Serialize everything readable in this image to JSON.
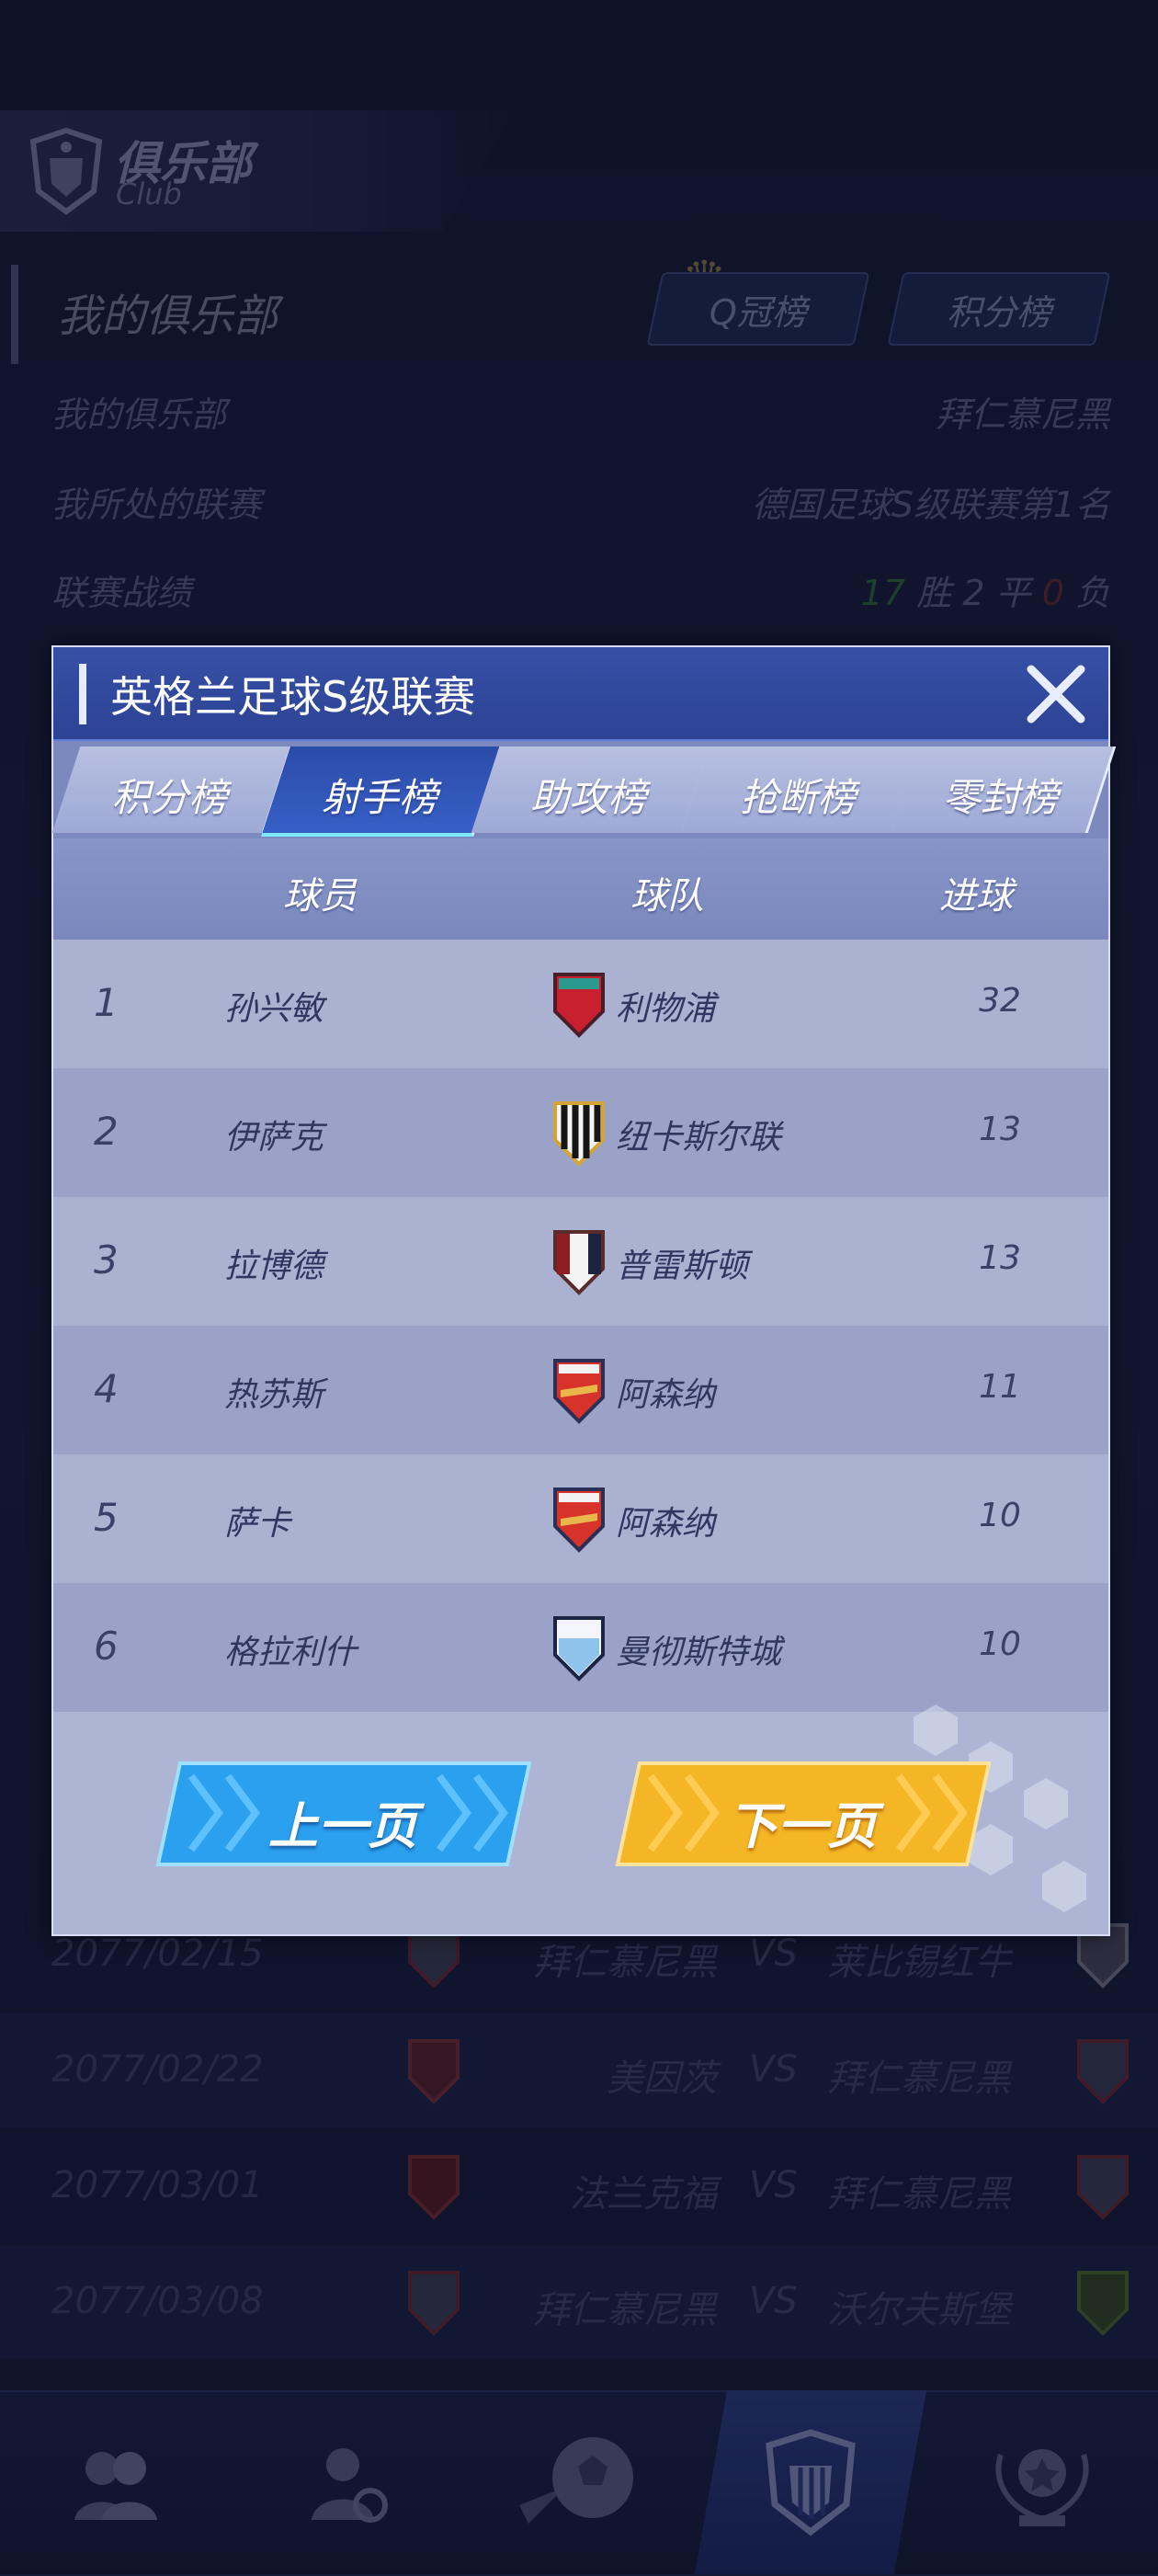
{
  "club_header": {
    "title": "俱乐部",
    "subtitle": "Club"
  },
  "section": {
    "title": "我的俱乐部",
    "q_rank_label": "Q冠榜",
    "points_rank_label": "积分榜"
  },
  "info_rows": [
    {
      "label": "我的俱乐部",
      "value": "拜仁慕尼黑"
    },
    {
      "label": "我所处的联赛",
      "value": "德国足球S级联赛第1名"
    }
  ],
  "record": {
    "label": "联赛战绩",
    "wins": "17",
    "wins_label": "胜",
    "draws": "2",
    "draws_label": "平",
    "losses": "0",
    "losses_label": "负"
  },
  "schedule": [
    {
      "date": "2077/02/15",
      "home": "拜仁慕尼黑",
      "vs": "VS",
      "away": "莱比锡红牛"
    },
    {
      "date": "2077/02/22",
      "home": "美因茨",
      "vs": "VS",
      "away": "拜仁慕尼黑"
    },
    {
      "date": "2077/03/01",
      "home": "法兰克福",
      "vs": "VS",
      "away": "拜仁慕尼黑"
    },
    {
      "date": "2077/03/08",
      "home": "拜仁慕尼黑",
      "vs": "VS",
      "away": "沃尔夫斯堡"
    }
  ],
  "modal": {
    "title": "英格兰足球S级联赛",
    "tabs": [
      {
        "label": "积分榜",
        "active": false
      },
      {
        "label": "射手榜",
        "active": true
      },
      {
        "label": "助攻榜",
        "active": false
      },
      {
        "label": "抢断榜",
        "active": false
      },
      {
        "label": "零封榜",
        "active": false
      }
    ],
    "columns": {
      "player": "球员",
      "team": "球队",
      "goals": "进球"
    },
    "rows": [
      {
        "rank": "1",
        "player": "孙兴敏",
        "team": "利物浦",
        "goals": "32",
        "crest": "liverpool-crest-icon"
      },
      {
        "rank": "2",
        "player": "伊萨克",
        "team": "纽卡斯尔联",
        "goals": "13",
        "crest": "newcastle-crest-icon"
      },
      {
        "rank": "3",
        "player": "拉博德",
        "team": "普雷斯顿",
        "goals": "13",
        "crest": "preston-crest-icon"
      },
      {
        "rank": "4",
        "player": "热苏斯",
        "team": "阿森纳",
        "goals": "11",
        "crest": "arsenal-crest-icon"
      },
      {
        "rank": "5",
        "player": "萨卡",
        "team": "阿森纳",
        "goals": "10",
        "crest": "arsenal-crest-icon"
      },
      {
        "rank": "6",
        "player": "格拉利什",
        "team": "曼彻斯特城",
        "goals": "10",
        "crest": "man-city-crest-icon"
      }
    ],
    "prev_label": "上一页",
    "next_label": "下一页"
  },
  "nav": [
    {
      "icon": "team-icon"
    },
    {
      "icon": "transfer-icon"
    },
    {
      "icon": "match-ball-icon"
    },
    {
      "icon": "club-crest-icon"
    },
    {
      "icon": "trophy-icon"
    }
  ],
  "colors": {
    "modal_header": "#3650a6",
    "tab_active": "#2b4ba8",
    "prev_button": "#2fa8f0",
    "next_button": "#f5b626",
    "win_green": "#2e6a3a",
    "loss_red": "#6c2730"
  }
}
